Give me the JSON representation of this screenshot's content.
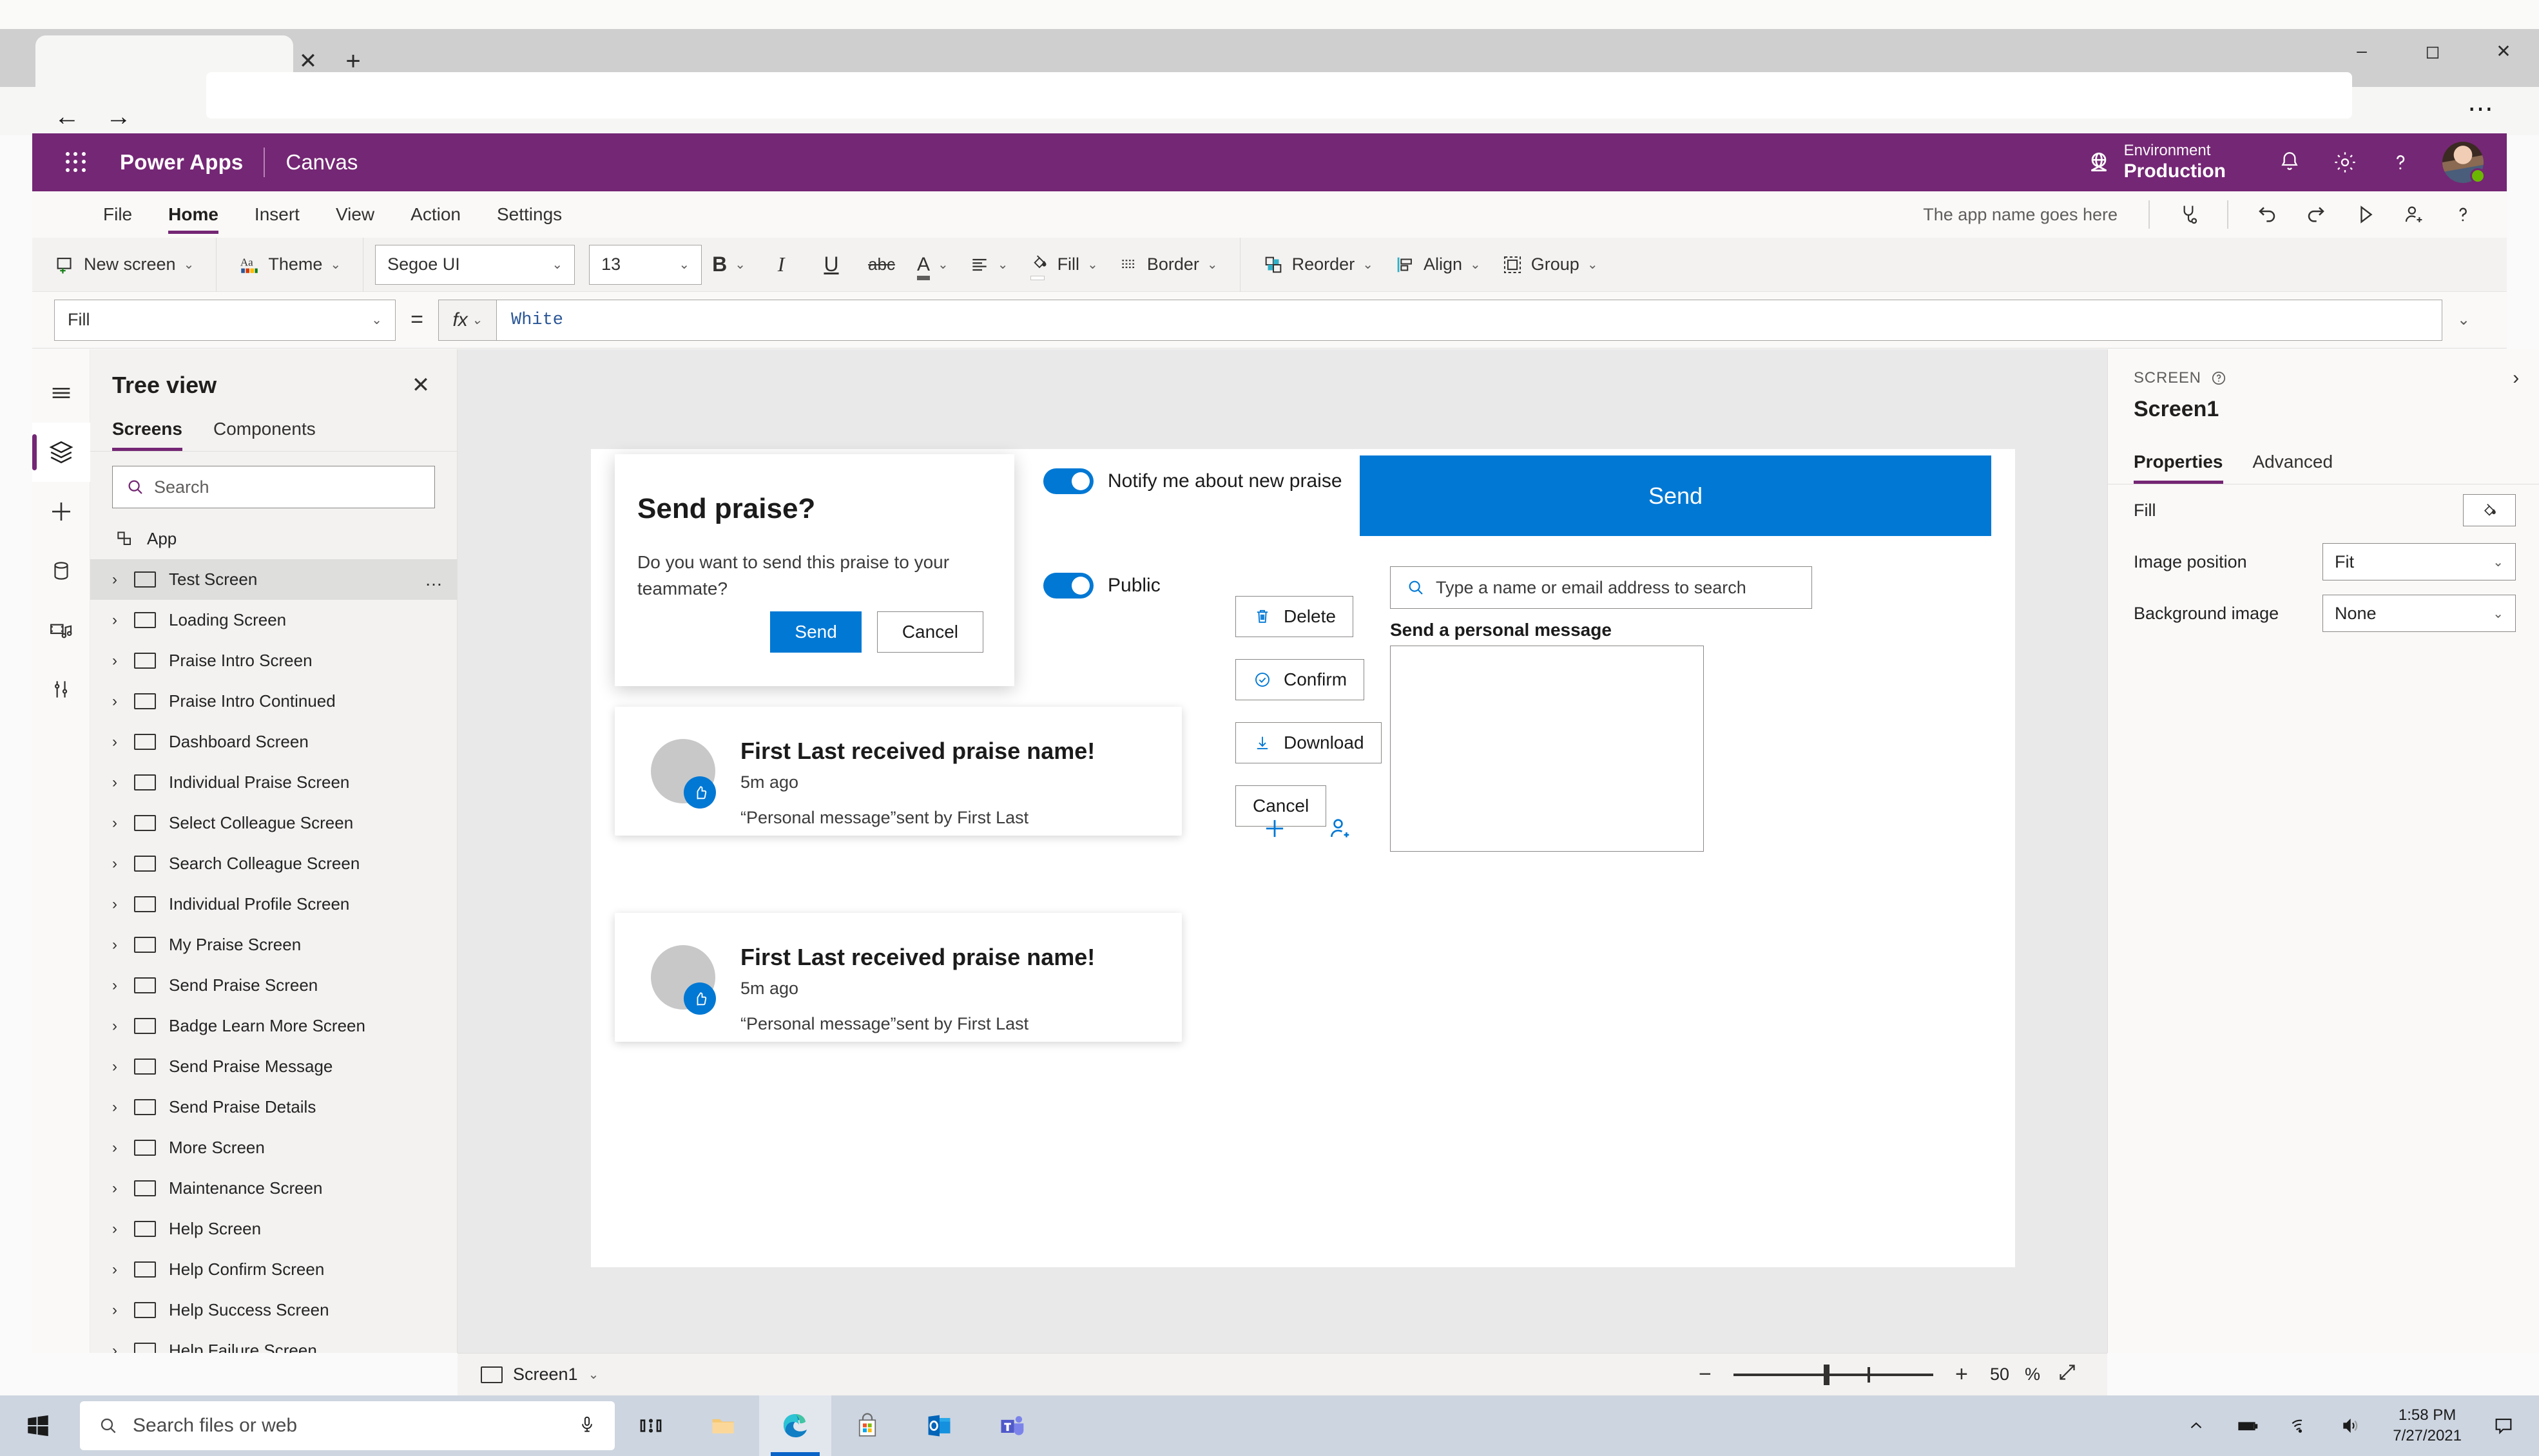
{
  "browser": {
    "tab_title": "",
    "close_tab_icon": "close-icon",
    "new_tab_icon": "plus-icon",
    "back_icon": "arrow-left-icon",
    "forward_icon": "arrow-right-icon",
    "more_icon": "ellipsis-icon",
    "minimize_icon": "minimize-icon",
    "maximize_icon": "maximize-icon",
    "close_window_icon": "close-icon"
  },
  "header": {
    "waffle_icon": "app-launcher-icon",
    "product": "Power Apps",
    "app_type": "Canvas",
    "environment_label": "Environment",
    "environment_value": "Production",
    "environment_icon": "globe-icon",
    "notifications_icon": "bell-icon",
    "settings_icon": "gear-icon",
    "help_icon": "question-icon",
    "avatar_icon": "avatar",
    "brand_color": "#742774",
    "presence_color": "#6bb700"
  },
  "ribbon": {
    "tabs": [
      {
        "label": "File",
        "active": false
      },
      {
        "label": "Home",
        "active": true
      },
      {
        "label": "Insert",
        "active": false
      },
      {
        "label": "View",
        "active": false
      },
      {
        "label": "Action",
        "active": false
      },
      {
        "label": "Settings",
        "active": false
      }
    ],
    "app_name_hint": "The app name goes here",
    "right_icons": [
      {
        "name": "app-checker-icon"
      },
      {
        "name": "undo-icon"
      },
      {
        "name": "redo-icon"
      },
      {
        "name": "preview-play-icon"
      },
      {
        "name": "share-icon"
      },
      {
        "name": "help-icon"
      }
    ],
    "toolbar": {
      "new_screen": "New screen",
      "theme": "Theme",
      "font_family": "Segoe UI",
      "font_size": "13",
      "bold": "B",
      "italic": "I",
      "underline": "U",
      "strikethrough": "abc",
      "font_color": "A",
      "align": "align-icon",
      "fill": "Fill",
      "border": "Border",
      "reorder": "Reorder",
      "align_label": "Align",
      "group": "Group"
    }
  },
  "formula_bar": {
    "property": "Fill",
    "equals": "=",
    "fx": "fx",
    "value": "White",
    "expand_icon": "chevron-down-icon"
  },
  "left_rail": [
    {
      "name": "hamburger-menu-icon",
      "active": false
    },
    {
      "name": "tree-view-layers-icon",
      "active": true
    },
    {
      "name": "insert-plus-icon",
      "active": false
    },
    {
      "name": "data-cylinder-icon",
      "active": false
    },
    {
      "name": "media-icon",
      "active": false
    },
    {
      "name": "advanced-tools-icon",
      "active": false
    }
  ],
  "treeview": {
    "title": "Tree view",
    "close_icon": "close-icon",
    "tabs": [
      {
        "label": "Screens",
        "active": true
      },
      {
        "label": "Components",
        "active": false
      }
    ],
    "search_placeholder": "Search",
    "search_icon": "search-icon",
    "app_node": "App",
    "app_icon": "app-node-icon",
    "screens": [
      {
        "label": "Test Screen",
        "selected": true
      },
      {
        "label": "Loading Screen",
        "selected": false
      },
      {
        "label": "Praise Intro Screen",
        "selected": false
      },
      {
        "label": "Praise Intro Continued",
        "selected": false
      },
      {
        "label": "Dashboard Screen",
        "selected": false
      },
      {
        "label": "Individual Praise Screen",
        "selected": false
      },
      {
        "label": "Select Colleague Screen",
        "selected": false
      },
      {
        "label": "Search Colleague Screen",
        "selected": false
      },
      {
        "label": "Individual Profile Screen",
        "selected": false
      },
      {
        "label": "My Praise Screen",
        "selected": false
      },
      {
        "label": "Send Praise Screen",
        "selected": false
      },
      {
        "label": "Badge Learn More Screen",
        "selected": false
      },
      {
        "label": "Send Praise Message",
        "selected": false
      },
      {
        "label": "Send Praise Details",
        "selected": false
      },
      {
        "label": "More Screen",
        "selected": false
      },
      {
        "label": "Maintenance Screen",
        "selected": false
      },
      {
        "label": "Help Screen",
        "selected": false
      },
      {
        "label": "Help Confirm Screen",
        "selected": false
      },
      {
        "label": "Help Success Screen",
        "selected": false
      },
      {
        "label": "Help Failure Screen",
        "selected": false
      }
    ]
  },
  "canvas": {
    "dialog": {
      "title": "Send praise?",
      "body": "Do you want to send this praise to your teammate?",
      "primary_button": "Send",
      "secondary_button": "Cancel",
      "primary_color": "#0078d4"
    },
    "notify_toggle": {
      "label": "Notify me about new praise",
      "on": true
    },
    "public_toggle": {
      "label": "Public",
      "on": true
    },
    "send_button": "Send",
    "people_search_placeholder": "Type a name or email address to search",
    "people_search_icon": "search-icon",
    "message_label": "Send a personal message",
    "message_value": "",
    "buttons": [
      {
        "label": "Delete",
        "icon": "trash-icon"
      },
      {
        "label": "Confirm",
        "icon": "check-circle-icon"
      },
      {
        "label": "Download",
        "icon": "download-icon"
      },
      {
        "label": "Cancel",
        "icon": ""
      }
    ],
    "bottom_icons": [
      {
        "name": "add-plus-icon"
      },
      {
        "name": "add-person-icon"
      }
    ],
    "praise_cards": [
      {
        "title": "First Last received praise name!",
        "time": "5m ago",
        "message": "“Personal message”sent by First Last",
        "badge_icon": "thumbs-up-icon"
      },
      {
        "title": "First Last received praise name!",
        "time": "5m ago",
        "message": "“Personal message”sent by First Last",
        "badge_icon": "thumbs-up-icon"
      }
    ]
  },
  "status_bar": {
    "screen_name": "Screen1",
    "screen_icon": "screen-icon",
    "chevron_icon": "chevron-down-icon",
    "zoom_out_icon": "minus-icon",
    "zoom_in_icon": "plus-icon",
    "zoom_value": "50",
    "zoom_unit": "%",
    "fit_icon": "expand-diagonal-icon"
  },
  "properties": {
    "kicker": "SCREEN",
    "kicker_help_icon": "question-circle-icon",
    "collapse_icon": "chevron-right-icon",
    "name": "Screen1",
    "tabs": [
      {
        "label": "Properties",
        "active": true
      },
      {
        "label": "Advanced",
        "active": false
      }
    ],
    "rows": [
      {
        "label": "Fill",
        "type": "swatch",
        "value": "",
        "icon": "fill-bucket-icon"
      },
      {
        "label": "Image position",
        "type": "select",
        "value": "Fit"
      },
      {
        "label": "Background image",
        "type": "select",
        "value": "None"
      }
    ]
  },
  "taskbar": {
    "start_icon": "windows-logo-icon",
    "search_placeholder": "Search files or web",
    "search_icon": "search-icon",
    "mic_icon": "microphone-icon",
    "apps": [
      {
        "name": "task-view-icon",
        "active": false
      },
      {
        "name": "file-explorer-icon",
        "active": false
      },
      {
        "name": "edge-browser-icon",
        "active": true
      },
      {
        "name": "microsoft-store-icon",
        "active": false
      },
      {
        "name": "outlook-icon",
        "active": false
      },
      {
        "name": "teams-icon",
        "active": false
      }
    ],
    "tray": [
      {
        "name": "show-hidden-icons-icon"
      },
      {
        "name": "battery-icon"
      },
      {
        "name": "wifi-icon"
      },
      {
        "name": "volume-icon"
      }
    ],
    "time": "1:58 PM",
    "date": "7/27/2021",
    "action-center_icon": "action-center-icon"
  }
}
